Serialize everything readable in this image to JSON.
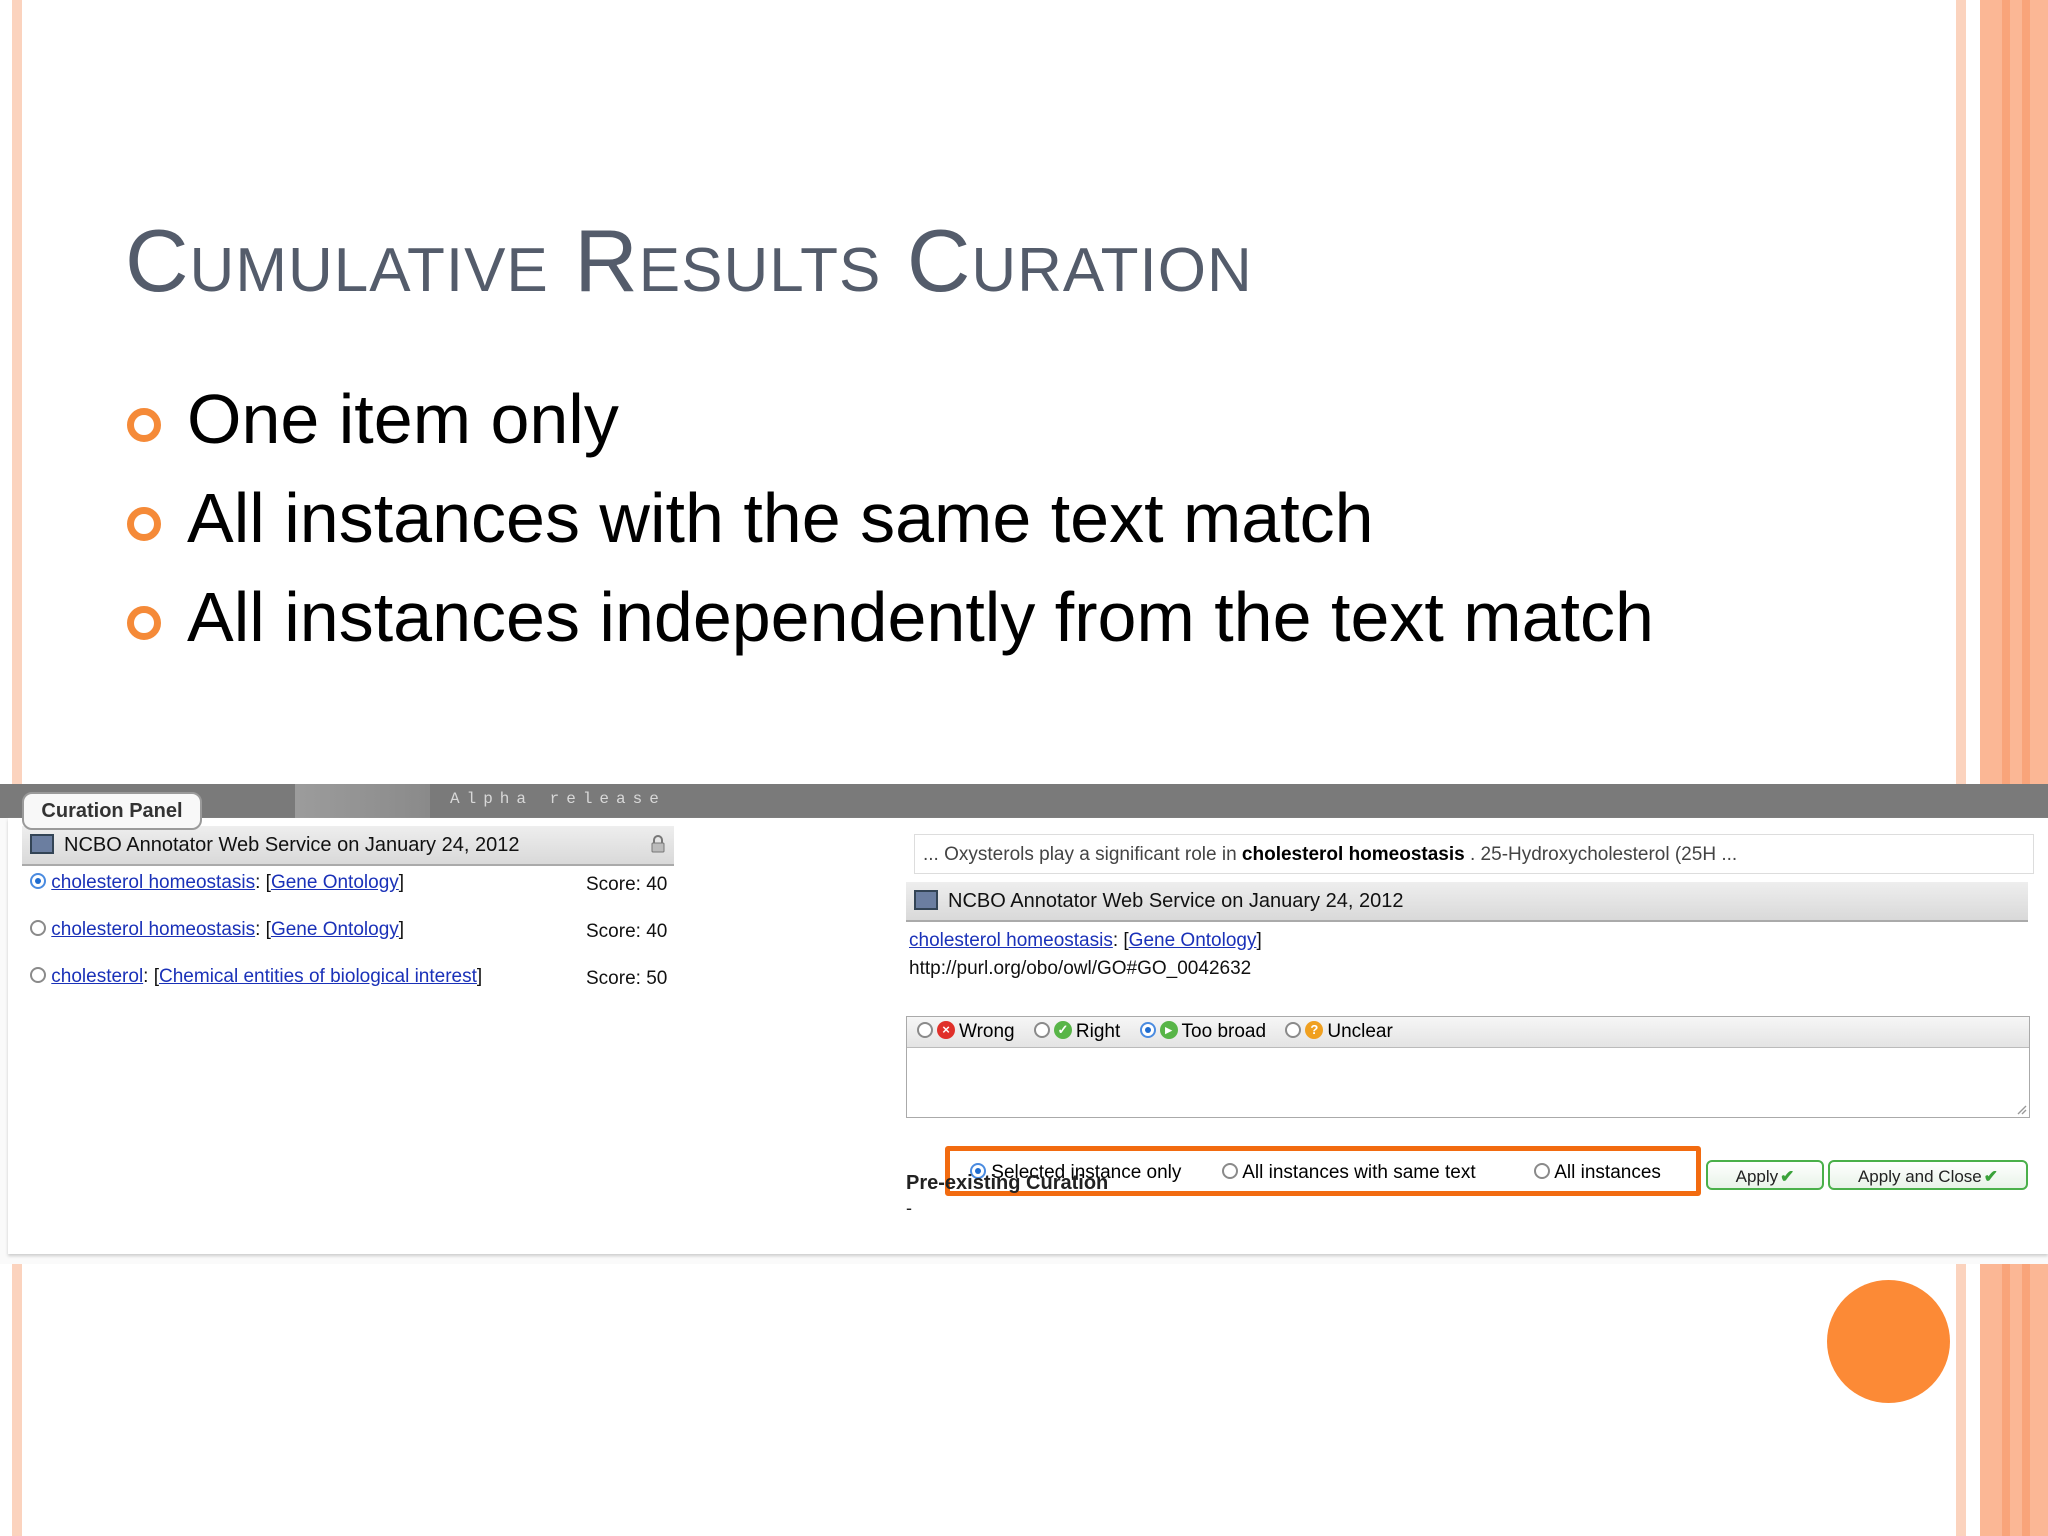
{
  "slide": {
    "title": "Cumulative Results Curation",
    "bullets": [
      "One item only",
      "All instances with the same text match",
      "All instances independently from the text match"
    ]
  },
  "colors": {
    "accent_orange": "#f58a38",
    "highlight_orange": "#f26b10",
    "link_blue": "#1a31b8",
    "title_gray": "#545c6b",
    "button_green": "#4ab04a"
  },
  "app": {
    "tab_label": "Curation Panel",
    "release_label": "Alpha release",
    "left": {
      "header": "NCBO Annotator Web Service on January 24, 2012",
      "results": [
        {
          "term": "cholesterol homeostasis",
          "ontology": "Gene Ontology",
          "score": "Score: 40",
          "selected": true
        },
        {
          "term": "cholesterol homeostasis",
          "ontology": "Gene Ontology",
          "score": "Score: 40",
          "selected": false
        },
        {
          "term": "cholesterol",
          "ontology": "Chemical entities of biological interest",
          "score": "Score: 50",
          "selected": false
        }
      ]
    },
    "right": {
      "snippet_pre": "... Oxysterols play a significant role in ",
      "snippet_bold": "cholesterol homeostasis",
      "snippet_post": " . 25-Hydroxycholesterol (25H ...",
      "header": "NCBO Annotator Web Service on January 24, 2012",
      "term": "cholesterol homeostasis",
      "ontology": "Gene Ontology",
      "uri": "http://purl.org/obo/owl/GO#GO_0042632",
      "curation_options": [
        {
          "label": "Wrong",
          "icon": "wrong-icon",
          "selected": false
        },
        {
          "label": "Right",
          "icon": "right-icon",
          "selected": false
        },
        {
          "label": "Too broad",
          "icon": "too-broad-icon",
          "selected": true
        },
        {
          "label": "Unclear",
          "icon": "unclear-icon",
          "selected": false
        }
      ],
      "scope_options": [
        {
          "label": "Selected instance only",
          "selected": true
        },
        {
          "label": "All instances with same text",
          "selected": false
        },
        {
          "label": "All instances",
          "selected": false
        }
      ],
      "apply_label": "Apply",
      "apply_close_label": "Apply and Close",
      "preexisting_label": "Pre-existing Curation",
      "preexisting_value": "-"
    }
  }
}
